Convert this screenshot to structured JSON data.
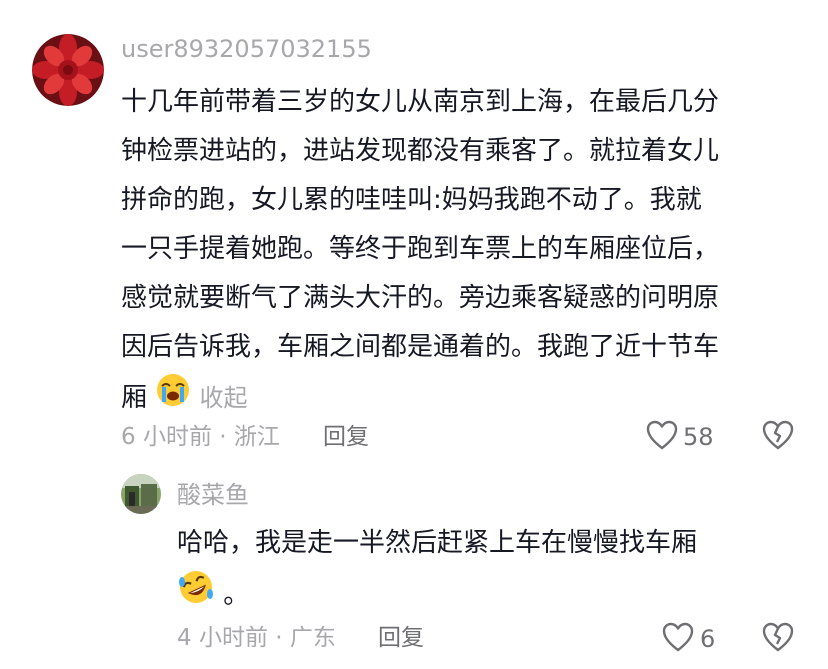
{
  "comments": [
    {
      "username": "user8932057032155",
      "lines": [
        "十几年前带着三岁的女儿从南京到上海，在最后几分",
        "钟检票进站的，进站发现都没有乘客了。就拉着女儿",
        "拼命的跑，女儿累的哇哇叫:妈妈我跑不动了。我就",
        "一只手提着她跑。等终于跑到车票上的车厢座位后，",
        "感觉就要断气了满头大汗的。旁边乘客疑惑的问明原",
        "因后告诉我，车厢之间都是通着的。我跑了近十节车",
        "厢"
      ],
      "emoji": "crying-face-icon",
      "collapse_label": "收起",
      "time_location": "6 小时前 · 浙江",
      "reply_label": "回复",
      "like_count": "58"
    },
    {
      "username": "酸菜鱼",
      "lines": [
        "哈哈，我是走一半然后赶紧上车在慢慢找车厢"
      ],
      "trailing_text": "。",
      "emoji": "rolling-laughing-face-icon",
      "time_location": "4 小时前 · 广东",
      "reply_label": "回复",
      "like_count": "6"
    }
  ],
  "colors": {
    "text": "#161823",
    "meta": "#a8a8ac",
    "action": "#6f6f73"
  }
}
